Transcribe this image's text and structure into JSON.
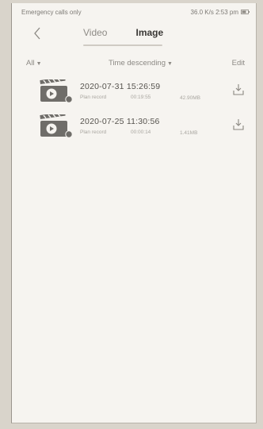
{
  "statusbar": {
    "left": "Emergency calls only",
    "right": "36.0 K/s 2:53 pm"
  },
  "nav": {
    "back_icon": "chevron-left-icon",
    "tabs": [
      {
        "label": "Video",
        "active": false
      },
      {
        "label": "Image",
        "active": true
      }
    ]
  },
  "filter": {
    "all": "All",
    "sort": "Time descending",
    "edit": "Edit"
  },
  "records": [
    {
      "time": "2020-07-31 15:26:59",
      "type": "Plan record",
      "duration": "00:19:55",
      "size": "42.90MB",
      "icon": "video-thumbnail-icon",
      "action_icon": "download-icon"
    },
    {
      "time": "2020-07-25 11:30:56",
      "type": "Plan record",
      "duration": "00:00:14",
      "size": "1.41MB",
      "icon": "video-thumbnail-icon",
      "action_icon": "download-icon"
    }
  ],
  "colors": {
    "background": "#f6f4f0",
    "text_primary": "#3a3835",
    "text_secondary": "#8e8b86",
    "thumbnail": "#6f6d69"
  }
}
